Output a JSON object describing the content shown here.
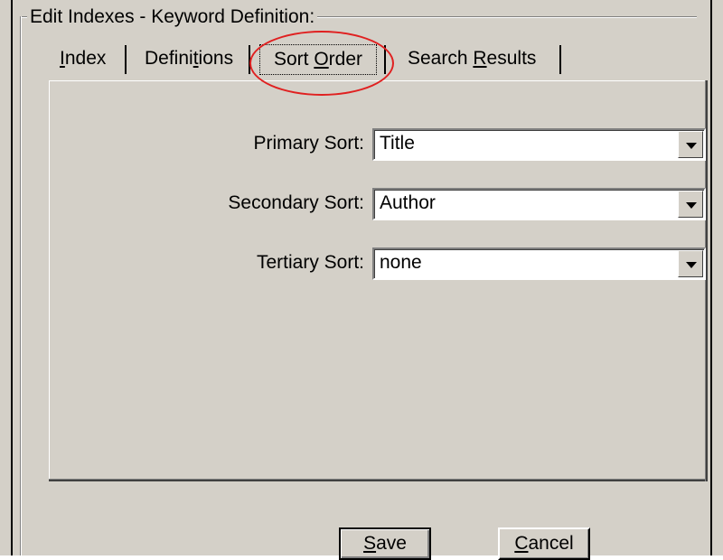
{
  "dialog": {
    "group_title": "Edit Indexes - Keyword Definition:"
  },
  "tabs": [
    {
      "pre": "",
      "mn": "I",
      "post": "ndex",
      "active": false
    },
    {
      "pre": "Defini",
      "mn": "t",
      "post": "ions",
      "active": false
    },
    {
      "pre": "Sort ",
      "mn": "O",
      "post": "rder",
      "active": true
    },
    {
      "pre": "Search ",
      "mn": "R",
      "post": "esults",
      "active": false
    }
  ],
  "sort_fields": {
    "primary": {
      "label": "Primary Sort:",
      "value": "Title"
    },
    "secondary": {
      "label": "Secondary Sort:",
      "value": "Author"
    },
    "tertiary": {
      "label": "Tertiary Sort:",
      "value": "none"
    }
  },
  "buttons": {
    "save": {
      "mn": "S",
      "post": "ave"
    },
    "cancel": {
      "mn": "C",
      "post": "ancel"
    }
  },
  "annotation": {
    "color": "#e02020",
    "shape": "ellipse",
    "target": "Sort Order tab"
  },
  "colors": {
    "dialog_bg": "#d4d0c8",
    "field_bg": "#ffffff"
  }
}
